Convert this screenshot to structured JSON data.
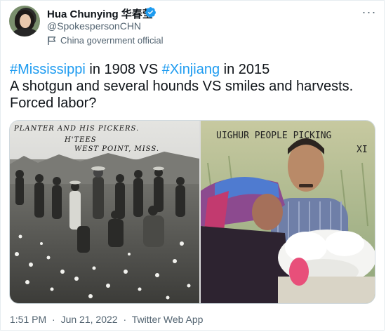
{
  "tweet": {
    "author": {
      "display_name": "Hua Chunying 华春莹",
      "handle": "@SpokespersonCHN",
      "label": "China government official",
      "avatar_icon": "avatar",
      "verified_icon": "verified-badge-icon",
      "verified_color": "#1d9bf0"
    },
    "more_label": "···",
    "text": {
      "line1": {
        "tag1": "#Mississippi",
        "mid": " in 1908 VS ",
        "tag2": "#Xinjiang",
        "end": " in 2015"
      },
      "line2": "A shotgun and several hounds VS smiles and harvests.",
      "line3": "Forced labor?"
    },
    "media": {
      "left_caption_1": "PLANTER AND HIS PICKERS.",
      "left_caption_2": "H'TEES",
      "left_caption_3": "WEST POINT, MISS.",
      "right_caption_1": "UIGHUR PEOPLE PICKING",
      "right_caption_2": "XI"
    },
    "footer": {
      "time": "1:51 PM",
      "date": "Jun 21, 2022",
      "app": "Twitter Web App",
      "separator": "·"
    }
  },
  "colors": {
    "hashtag": "#1d9bf0",
    "text_primary": "#0f1419",
    "text_secondary": "#536471"
  }
}
